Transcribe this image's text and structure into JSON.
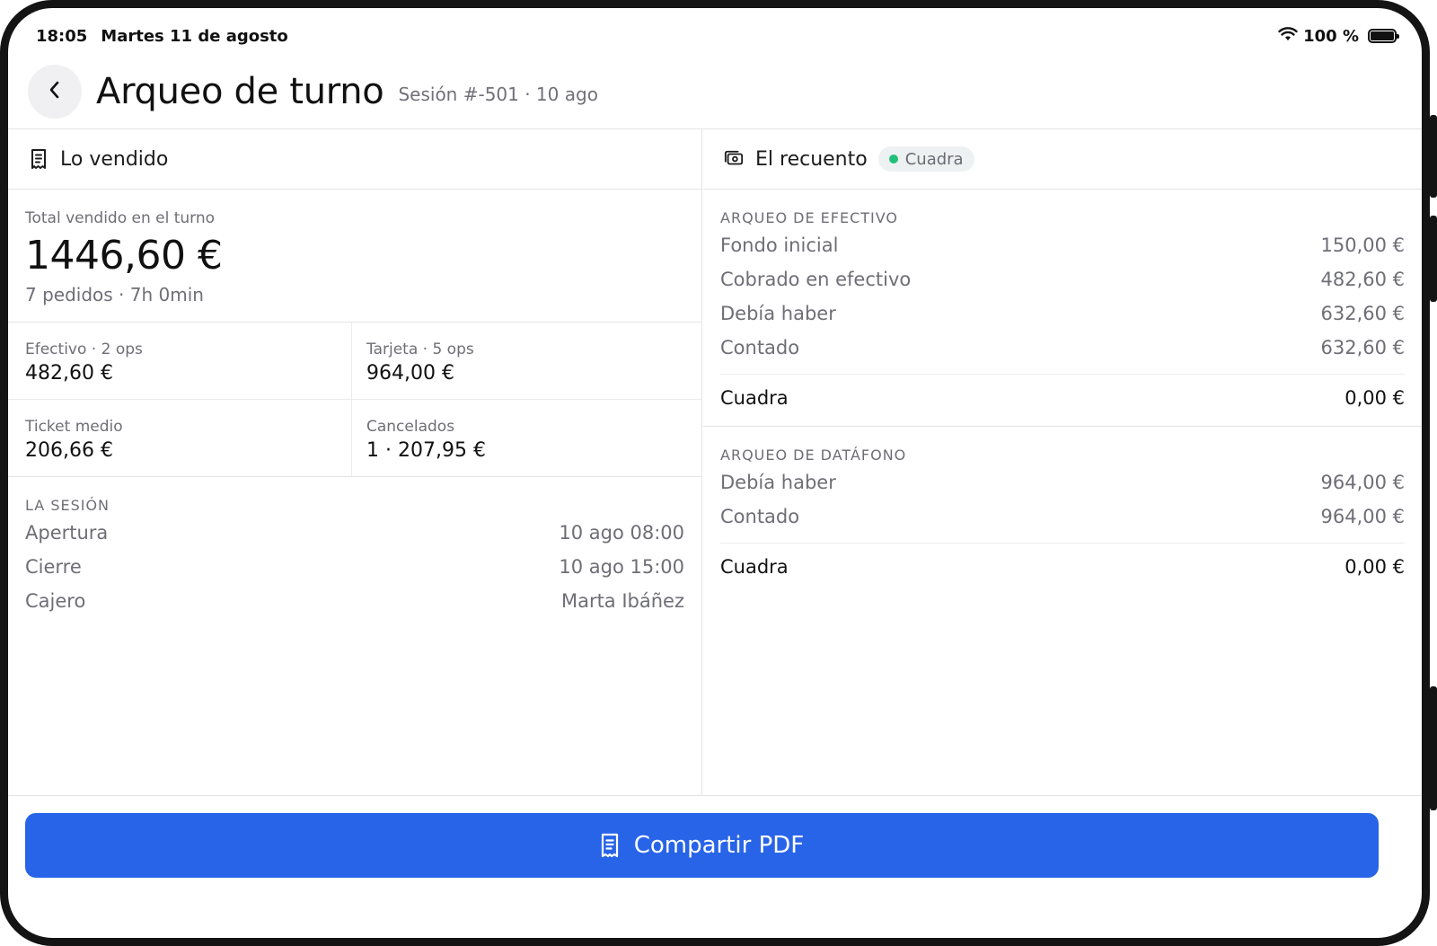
{
  "status_bar": {
    "time": "18:05",
    "date": "Martes 11 de agosto",
    "battery": "100 %"
  },
  "header": {
    "title": "Arqueo de turno",
    "subtitle": "Sesión #-501 · 10 ago"
  },
  "sold": {
    "heading": "Lo vendido",
    "total_label": "Total vendido en el turno",
    "total_value": "1446,60 €",
    "total_sub": "7 pedidos · 7h 0min",
    "stats": [
      {
        "label": "Efectivo · 2 ops",
        "value": "482,60 €"
      },
      {
        "label": "Tarjeta · 5 ops",
        "value": "964,00 €"
      },
      {
        "label": "Ticket medio",
        "value": "206,66 €"
      },
      {
        "label": "Cancelados",
        "value": "1 · 207,95 €"
      }
    ],
    "session": {
      "label": "LA SESIÓN",
      "rows": [
        {
          "label": "Apertura",
          "value": "10 ago 08:00"
        },
        {
          "label": "Cierre",
          "value": "10 ago 15:00"
        },
        {
          "label": "Cajero",
          "value": "Marta Ibáñez"
        }
      ]
    }
  },
  "count": {
    "heading": "El recuento",
    "badge": "Cuadra",
    "badge_color": "#22c07a",
    "cash": {
      "label": "ARQUEO DE EFECTIVO",
      "rows": [
        {
          "label": "Fondo inicial",
          "value": "150,00 €"
        },
        {
          "label": "Cobrado en efectivo",
          "value": "482,60 €"
        },
        {
          "label": "Debía haber",
          "value": "632,60 €"
        },
        {
          "label": "Contado",
          "value": "632,60 €"
        }
      ],
      "result": {
        "label": "Cuadra",
        "value": "0,00 €"
      }
    },
    "card": {
      "label": "ARQUEO DE DATÁFONO",
      "rows": [
        {
          "label": "Debía haber",
          "value": "964,00 €"
        },
        {
          "label": "Contado",
          "value": "964,00 €"
        }
      ],
      "result": {
        "label": "Cuadra",
        "value": "0,00 €"
      }
    }
  },
  "footer": {
    "share_label": "Compartir PDF",
    "accent": "#2864e8"
  },
  "icons": [
    "wifi-icon",
    "battery-icon",
    "chevron-left-icon",
    "receipt-icon",
    "cash-icon"
  ]
}
